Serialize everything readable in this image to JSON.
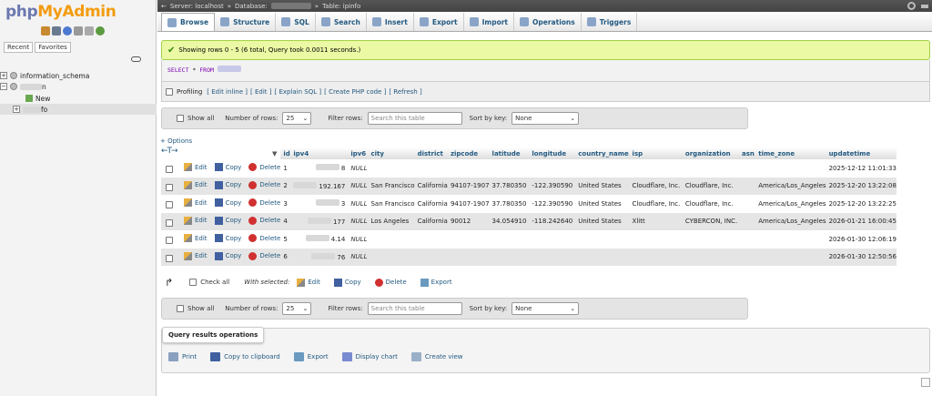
{
  "nav": {
    "logo_php": "php",
    "logo_myadmin": "MyAdmin",
    "tabs": [
      "Recent",
      "Favorites"
    ],
    "tree": [
      {
        "label": "information_schema"
      },
      {
        "label": "n"
      },
      {
        "label": "New"
      },
      {
        "label": "fo"
      }
    ],
    "icons": [
      "home-icon",
      "database-icon",
      "help-icon",
      "docs-icon",
      "settings-icon",
      "reload-icon"
    ]
  },
  "breadcrumb": {
    "server": "Server: localhost",
    "database": "Database:",
    "table": "Table: ipinfo"
  },
  "tabs": [
    "Browse",
    "Structure",
    "SQL",
    "Search",
    "Insert",
    "Export",
    "Import",
    "Operations",
    "Triggers"
  ],
  "message": "Showing rows 0 - 5 (6 total, Query took 0.0011 seconds.)",
  "sql": {
    "keyword": "SELECT",
    "star": "*",
    "from": "FROM",
    "table": "`      `"
  },
  "profiling": {
    "label": "Profiling",
    "links": [
      "[ Edit inline ]",
      "[ Edit ]",
      "[ Explain SQL ]",
      "[ Create PHP code ]",
      "[ Refresh ]"
    ]
  },
  "navbar": {
    "show_all": "Show all",
    "rows_label": "Number of rows:",
    "rows_value": "25",
    "filter_label": "Filter rows:",
    "filter_placeholder": "Search this table",
    "sort_label": "Sort by key:",
    "sort_value": "None"
  },
  "options_link": "+ Options",
  "columns": [
    "id",
    "ipv4",
    "ipv6",
    "city",
    "district",
    "zipcode",
    "latitude",
    "longitude",
    "country_name",
    "isp",
    "organization",
    "asn",
    "time_zone",
    "updatetime"
  ],
  "actions": {
    "edit": "Edit",
    "copy": "Copy",
    "delete": "Delete"
  },
  "rows": [
    {
      "id": "1",
      "ipv4": "8",
      "ipv6": "NULL",
      "city": "",
      "district": "",
      "zipcode": "",
      "latitude": "",
      "longitude": "",
      "country_name": "",
      "isp": "",
      "organization": "",
      "asn": "",
      "time_zone": "",
      "updatetime": "2025-12-12 11:01:33"
    },
    {
      "id": "2",
      "ipv4": "192.167",
      "ipv6": "NULL",
      "city": "San Francisco",
      "district": "California",
      "zipcode": "94107-1907",
      "latitude": "37.780350",
      "longitude": "-122.390590",
      "country_name": "United States",
      "isp": "Cloudflare, Inc.",
      "organization": "Cloudflare, Inc.",
      "asn": "",
      "time_zone": "America/Los_Angeles",
      "updatetime": "2025-12-20 13:22:08"
    },
    {
      "id": "3",
      "ipv4": "3",
      "ipv6": "NULL",
      "city": "San Francisco",
      "district": "California",
      "zipcode": "94107-1907",
      "latitude": "37.780350",
      "longitude": "-122.390590",
      "country_name": "United States",
      "isp": "Cloudflare, Inc.",
      "organization": "Cloudflare, Inc.",
      "asn": "",
      "time_zone": "America/Los_Angeles",
      "updatetime": "2025-12-20 13:22:25"
    },
    {
      "id": "4",
      "ipv4": "177",
      "ipv6": "NULL",
      "city": "Los Angeles",
      "district": "California",
      "zipcode": "90012",
      "latitude": "34.054910",
      "longitude": "-118.242640",
      "country_name": "United States",
      "isp": "Xlitt",
      "organization": "CYBERCON, INC.",
      "asn": "",
      "time_zone": "America/Los_Angeles",
      "updatetime": "2026-01-21 16:00:45"
    },
    {
      "id": "5",
      "ipv4": "4.14",
      "ipv6": "NULL",
      "city": "",
      "district": "",
      "zipcode": "",
      "latitude": "",
      "longitude": "",
      "country_name": "",
      "isp": "",
      "organization": "",
      "asn": "",
      "time_zone": "",
      "updatetime": "2026-01-30 12:06:19"
    },
    {
      "id": "6",
      "ipv4": "76",
      "ipv6": "NULL",
      "city": "",
      "district": "",
      "zipcode": "",
      "latitude": "",
      "longitude": "",
      "country_name": "",
      "isp": "",
      "organization": "",
      "asn": "",
      "time_zone": "",
      "updatetime": "2026-01-30 12:50:56"
    }
  ],
  "bottom": {
    "check_all": "Check all",
    "with_selected": "With selected:",
    "edit": "Edit",
    "copy": "Copy",
    "delete": "Delete",
    "export": "Export"
  },
  "qro": {
    "title": "Query results operations",
    "items": [
      "Print",
      "Copy to clipboard",
      "Export",
      "Display chart",
      "Create view"
    ]
  }
}
